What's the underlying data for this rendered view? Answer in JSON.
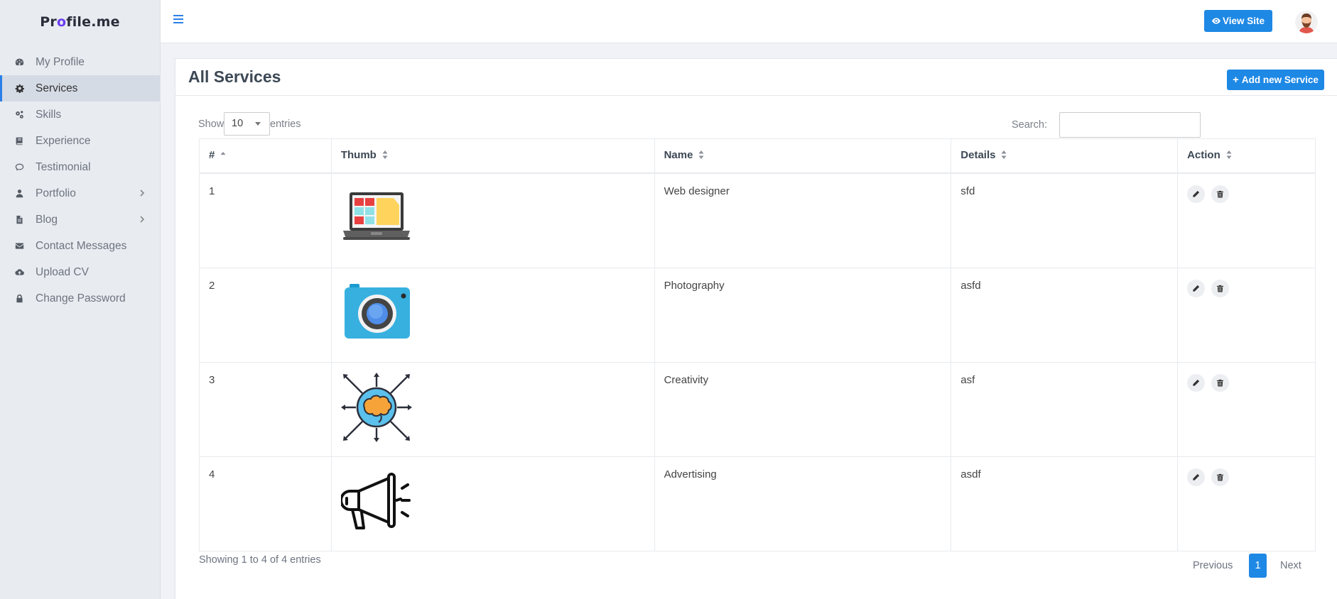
{
  "brand": {
    "part1": "Pr",
    "part2": "o",
    "part3": "file.me"
  },
  "sidebar": {
    "items": [
      {
        "label": "My Profile",
        "icon": "dashboard-icon"
      },
      {
        "label": "Services",
        "icon": "gear-icon",
        "active": true
      },
      {
        "label": "Skills",
        "icon": "gears-icon"
      },
      {
        "label": "Experience",
        "icon": "book-icon"
      },
      {
        "label": "Testimonial",
        "icon": "comment-icon"
      },
      {
        "label": "Portfolio",
        "icon": "user-icon",
        "has_submenu": true
      },
      {
        "label": "Blog",
        "icon": "file-text-icon",
        "has_submenu": true
      },
      {
        "label": "Contact Messages",
        "icon": "envelope-icon"
      },
      {
        "label": "Upload CV",
        "icon": "cloud-upload-icon"
      },
      {
        "label": "Change Password",
        "icon": "lock-icon"
      }
    ]
  },
  "topbar": {
    "view_site_label": "View Site"
  },
  "page": {
    "title": "All Services",
    "add_button_label": "Add new Service"
  },
  "controls": {
    "show_label": "Show",
    "entries_value": "10",
    "entries_label": "entries",
    "search_label": "Search:",
    "search_value": ""
  },
  "table": {
    "headers": [
      "#",
      "Thumb",
      "Name",
      "Details",
      "Action"
    ],
    "rows": [
      {
        "num": "1",
        "thumb": "laptop-icon",
        "name": "Web designer",
        "details": "sfd"
      },
      {
        "num": "2",
        "thumb": "camera-icon",
        "name": "Photography",
        "details": "asfd"
      },
      {
        "num": "3",
        "thumb": "brain-icon",
        "name": "Creativity",
        "details": "asf"
      },
      {
        "num": "4",
        "thumb": "megaphone-icon",
        "name": "Advertising",
        "details": "asdf"
      }
    ]
  },
  "footer": {
    "info": "Showing 1 to 4 of 4 entries",
    "previous_label": "Previous",
    "current_page": "1",
    "next_label": "Next"
  },
  "colors": {
    "accent": "#1e88e5",
    "sidebar_bg": "#e8ebf0",
    "active_item_bg": "#d5dbe5"
  }
}
